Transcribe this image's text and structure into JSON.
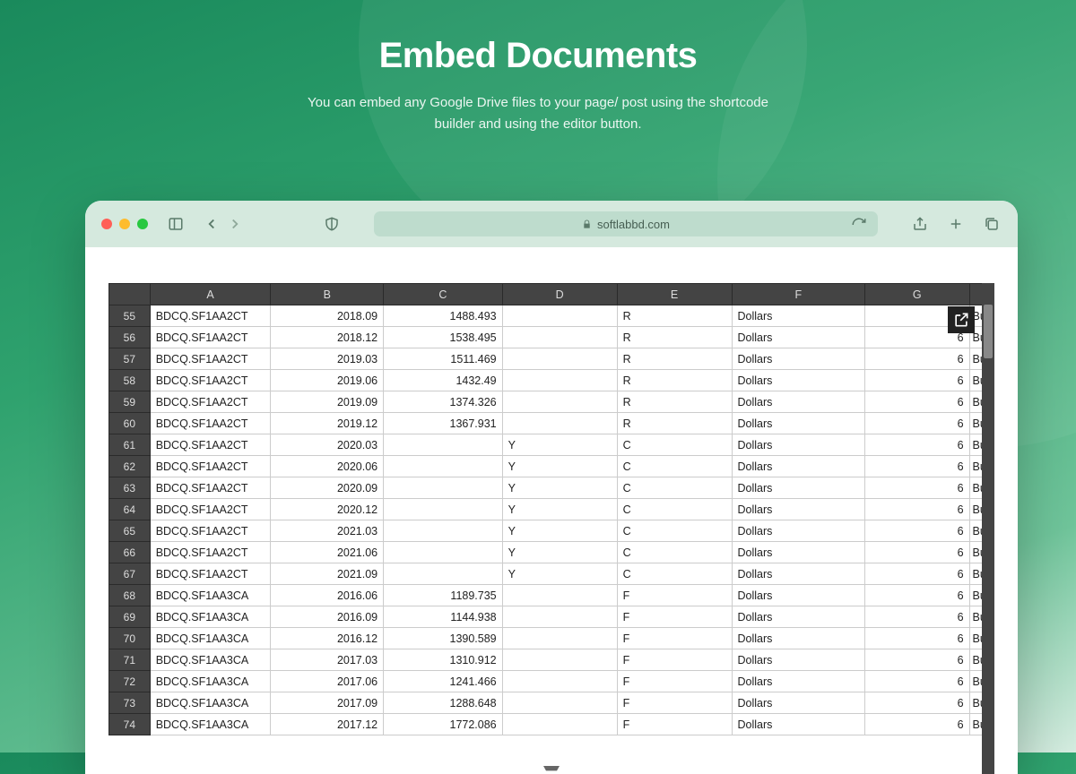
{
  "hero": {
    "title": "Embed Documents",
    "subtitle": "You can embed any Google Drive files to your page/ post using the shortcode builder and using the editor button."
  },
  "browser": {
    "url": "softlabbd.com"
  },
  "sheet": {
    "columns": [
      "A",
      "B",
      "C",
      "D",
      "E",
      "F",
      "G",
      ""
    ],
    "rows": [
      {
        "n": 55,
        "a": "BDCQ.SF1AA2CT",
        "b": "2018.09",
        "c": "1488.493",
        "d": "",
        "e": "R",
        "f": "Dollars",
        "g": "",
        "h": "Bu"
      },
      {
        "n": 56,
        "a": "BDCQ.SF1AA2CT",
        "b": "2018.12",
        "c": "1538.495",
        "d": "",
        "e": "R",
        "f": "Dollars",
        "g": "6",
        "h": "Bu"
      },
      {
        "n": 57,
        "a": "BDCQ.SF1AA2CT",
        "b": "2019.03",
        "c": "1511.469",
        "d": "",
        "e": "R",
        "f": "Dollars",
        "g": "6",
        "h": "Bu"
      },
      {
        "n": 58,
        "a": "BDCQ.SF1AA2CT",
        "b": "2019.06",
        "c": "1432.49",
        "d": "",
        "e": "R",
        "f": "Dollars",
        "g": "6",
        "h": "Bu"
      },
      {
        "n": 59,
        "a": "BDCQ.SF1AA2CT",
        "b": "2019.09",
        "c": "1374.326",
        "d": "",
        "e": "R",
        "f": "Dollars",
        "g": "6",
        "h": "Bu"
      },
      {
        "n": 60,
        "a": "BDCQ.SF1AA2CT",
        "b": "2019.12",
        "c": "1367.931",
        "d": "",
        "e": "R",
        "f": "Dollars",
        "g": "6",
        "h": "Bu"
      },
      {
        "n": 61,
        "a": "BDCQ.SF1AA2CT",
        "b": "2020.03",
        "c": "",
        "d": "Y",
        "e": "C",
        "f": "Dollars",
        "g": "6",
        "h": "Bu"
      },
      {
        "n": 62,
        "a": "BDCQ.SF1AA2CT",
        "b": "2020.06",
        "c": "",
        "d": "Y",
        "e": "C",
        "f": "Dollars",
        "g": "6",
        "h": "Bu"
      },
      {
        "n": 63,
        "a": "BDCQ.SF1AA2CT",
        "b": "2020.09",
        "c": "",
        "d": "Y",
        "e": "C",
        "f": "Dollars",
        "g": "6",
        "h": "Bu"
      },
      {
        "n": 64,
        "a": "BDCQ.SF1AA2CT",
        "b": "2020.12",
        "c": "",
        "d": "Y",
        "e": "C",
        "f": "Dollars",
        "g": "6",
        "h": "Bu"
      },
      {
        "n": 65,
        "a": "BDCQ.SF1AA2CT",
        "b": "2021.03",
        "c": "",
        "d": "Y",
        "e": "C",
        "f": "Dollars",
        "g": "6",
        "h": "Bu"
      },
      {
        "n": 66,
        "a": "BDCQ.SF1AA2CT",
        "b": "2021.06",
        "c": "",
        "d": "Y",
        "e": "C",
        "f": "Dollars",
        "g": "6",
        "h": "Bu"
      },
      {
        "n": 67,
        "a": "BDCQ.SF1AA2CT",
        "b": "2021.09",
        "c": "",
        "d": "Y",
        "e": "C",
        "f": "Dollars",
        "g": "6",
        "h": "Bu"
      },
      {
        "n": 68,
        "a": "BDCQ.SF1AA3CA",
        "b": "2016.06",
        "c": "1189.735",
        "d": "",
        "e": "F",
        "f": "Dollars",
        "g": "6",
        "h": "Bu"
      },
      {
        "n": 69,
        "a": "BDCQ.SF1AA3CA",
        "b": "2016.09",
        "c": "1144.938",
        "d": "",
        "e": "F",
        "f": "Dollars",
        "g": "6",
        "h": "Bu"
      },
      {
        "n": 70,
        "a": "BDCQ.SF1AA3CA",
        "b": "2016.12",
        "c": "1390.589",
        "d": "",
        "e": "F",
        "f": "Dollars",
        "g": "6",
        "h": "Bu"
      },
      {
        "n": 71,
        "a": "BDCQ.SF1AA3CA",
        "b": "2017.03",
        "c": "1310.912",
        "d": "",
        "e": "F",
        "f": "Dollars",
        "g": "6",
        "h": "Bu"
      },
      {
        "n": 72,
        "a": "BDCQ.SF1AA3CA",
        "b": "2017.06",
        "c": "1241.466",
        "d": "",
        "e": "F",
        "f": "Dollars",
        "g": "6",
        "h": "Bu"
      },
      {
        "n": 73,
        "a": "BDCQ.SF1AA3CA",
        "b": "2017.09",
        "c": "1288.648",
        "d": "",
        "e": "F",
        "f": "Dollars",
        "g": "6",
        "h": "Bu"
      },
      {
        "n": 74,
        "a": "BDCQ.SF1AA3CA",
        "b": "2017.12",
        "c": "1772.086",
        "d": "",
        "e": "F",
        "f": "Dollars",
        "g": "6",
        "h": "Bu"
      }
    ]
  }
}
